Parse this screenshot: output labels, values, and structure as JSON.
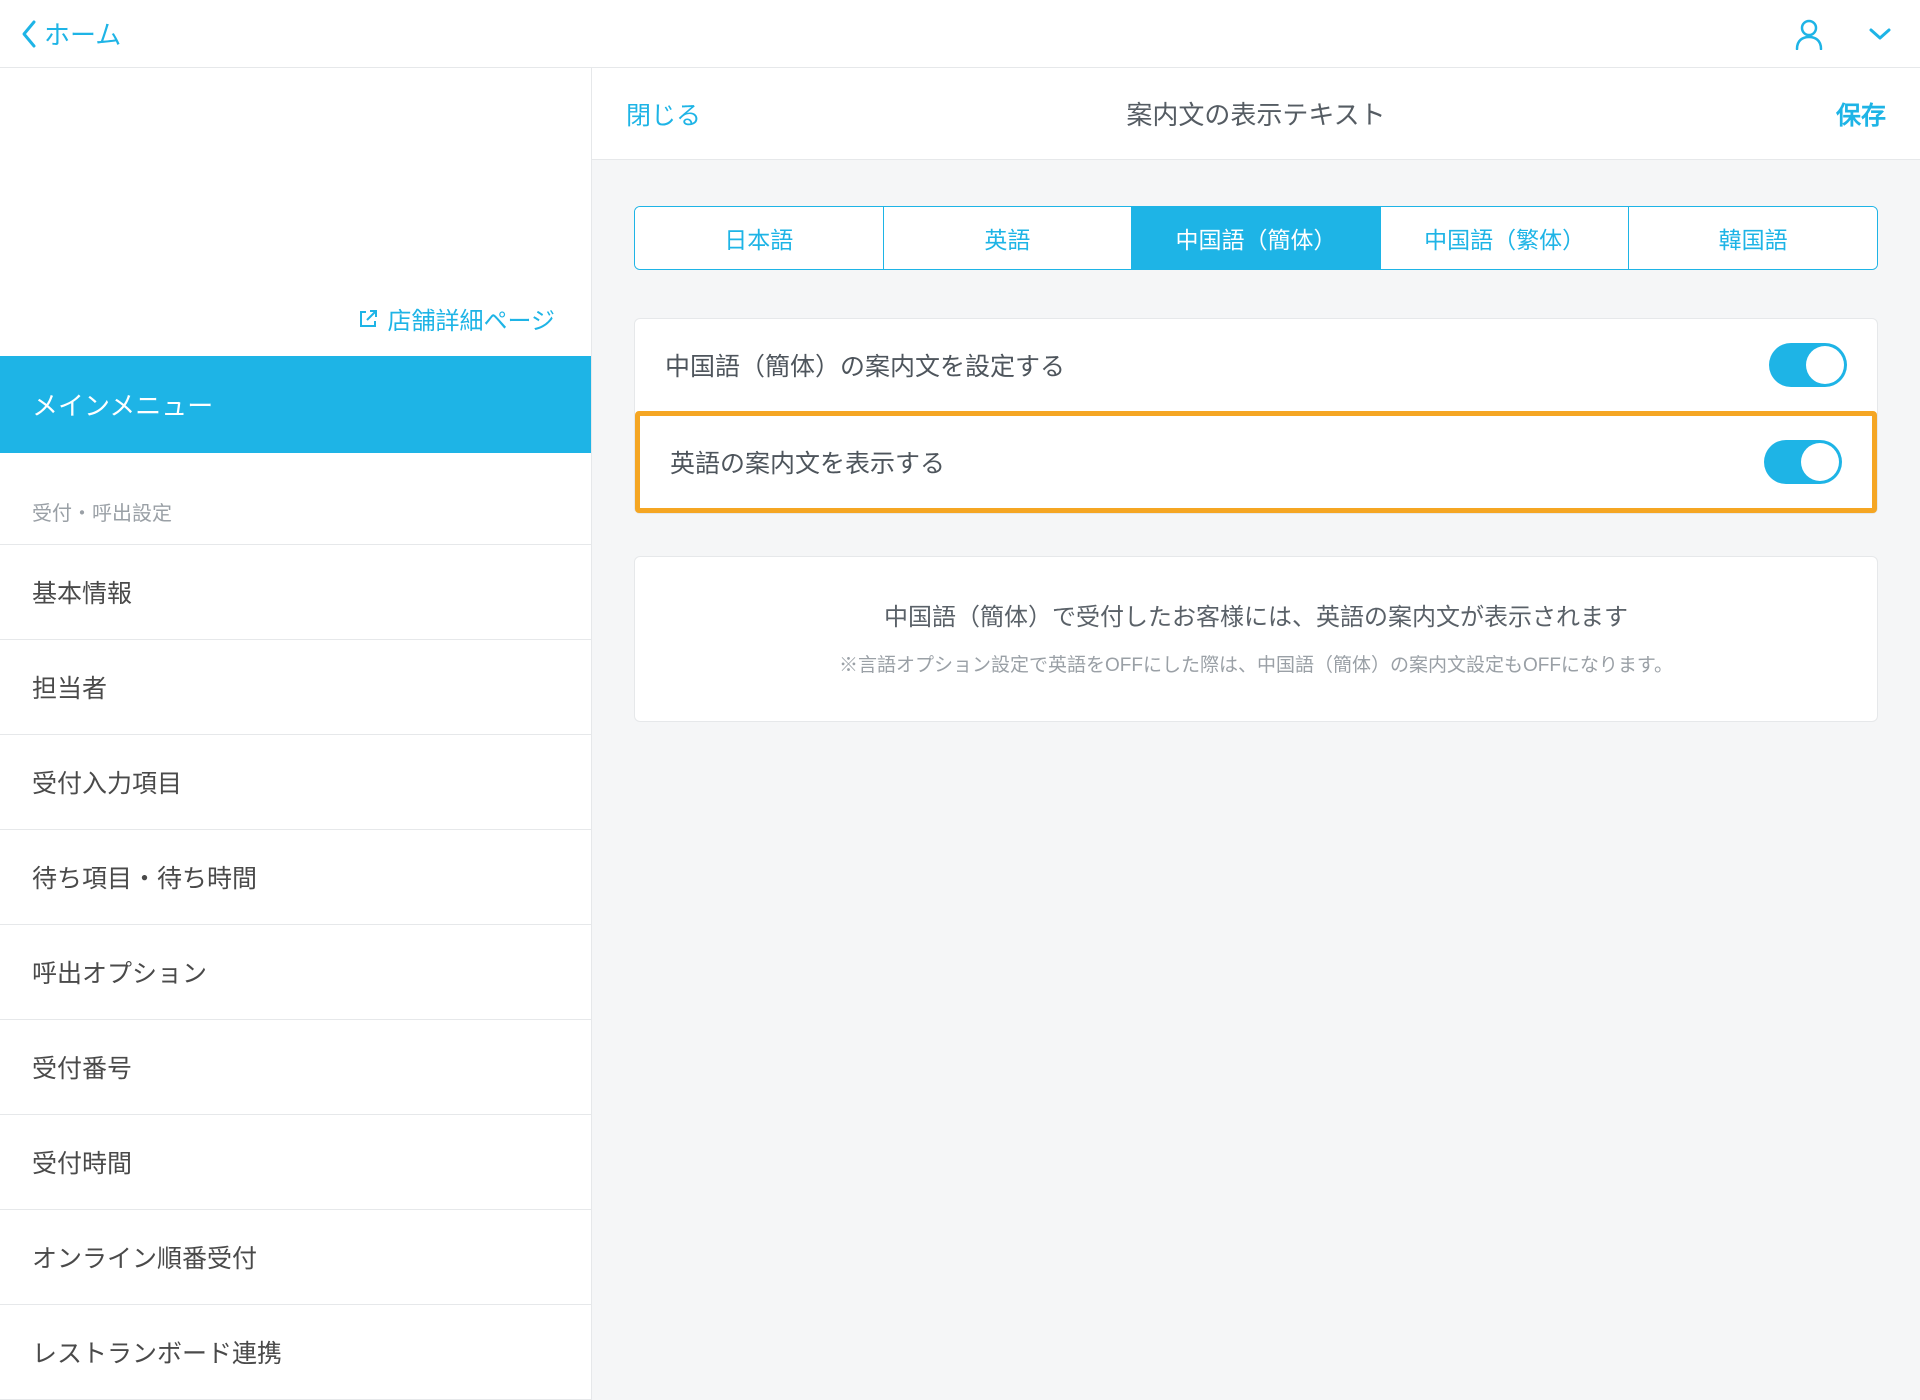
{
  "topbar": {
    "back_label": "ホーム"
  },
  "sidebar": {
    "store_link": "店舗詳細ページ",
    "main_menu": "メインメニュー",
    "section_header": "受付・呼出設定",
    "items": [
      "基本情報",
      "担当者",
      "受付入力項目",
      "待ち項目・待ち時間",
      "呼出オプション",
      "受付番号",
      "受付時間",
      "オンライン順番受付",
      "レストランボード連携"
    ]
  },
  "panel": {
    "close": "閉じる",
    "title": "案内文の表示テキスト",
    "save": "保存",
    "tabs": [
      "日本語",
      "英語",
      "中国語（簡体）",
      "中国語（繁体）",
      "韓国語"
    ],
    "active_tab_index": 2,
    "row1_label": "中国語（簡体）の案内文を設定する",
    "row2_label": "英語の案内文を表示する",
    "info_main": "中国語（簡体）で受付したお客様には、英語の案内文が表示されます",
    "info_note": "※言語オプション設定で英語をOFFにした際は、中国語（簡体）の案内文設定もOFFになります。"
  }
}
